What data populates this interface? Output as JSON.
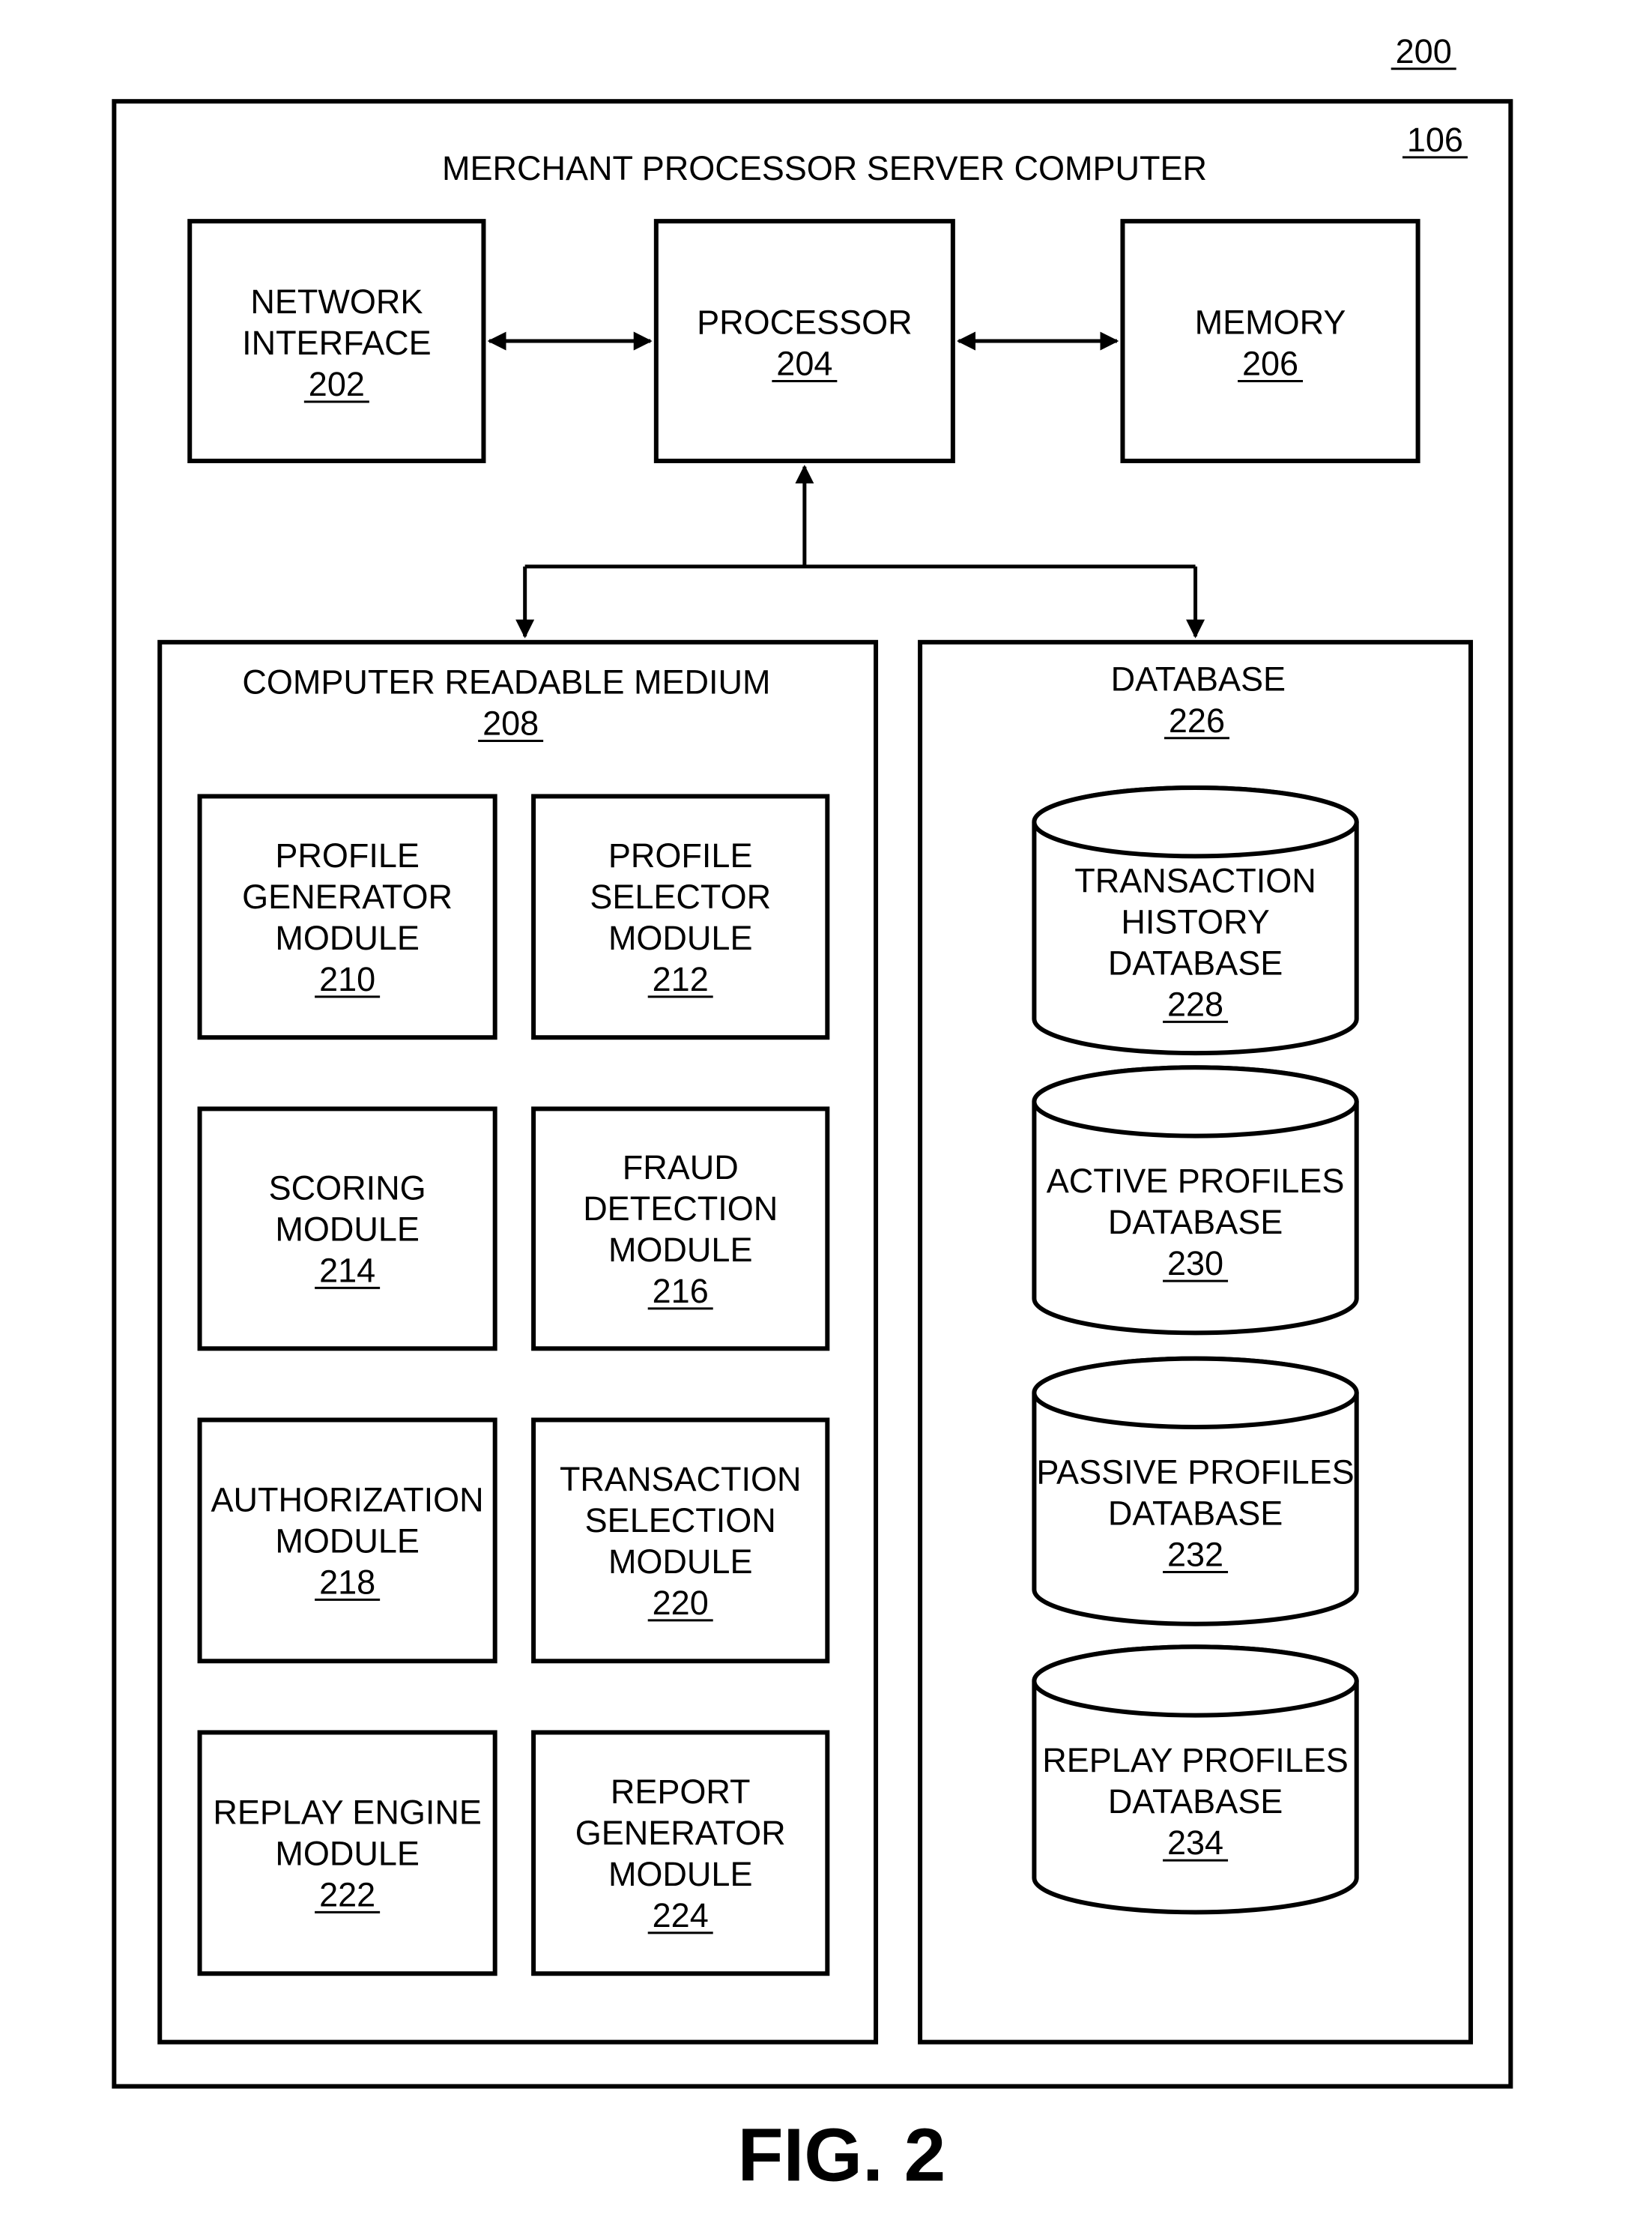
{
  "figure": {
    "ref": "200",
    "caption": "FIG. 2",
    "server": {
      "title": "MERCHANT PROCESSOR SERVER COMPUTER",
      "ref": "106"
    },
    "top_components": [
      {
        "id": "network",
        "lines": [
          "NETWORK",
          "INTERFACE"
        ],
        "ref": "202"
      },
      {
        "id": "processor",
        "lines": [
          "PROCESSOR"
        ],
        "ref": "204"
      },
      {
        "id": "memory",
        "lines": [
          "MEMORY"
        ],
        "ref": "206"
      }
    ],
    "crm": {
      "title": "COMPUTER READABLE MEDIUM",
      "ref": "208",
      "modules": [
        {
          "lines": [
            "PROFILE",
            "GENERATOR",
            "MODULE"
          ],
          "ref": "210"
        },
        {
          "lines": [
            "PROFILE",
            "SELECTOR",
            "MODULE"
          ],
          "ref": "212"
        },
        {
          "lines": [
            "SCORING",
            "MODULE"
          ],
          "ref": "214"
        },
        {
          "lines": [
            "FRAUD",
            "DETECTION",
            "MODULE"
          ],
          "ref": "216"
        },
        {
          "lines": [
            "AUTHORIZATION",
            "MODULE"
          ],
          "ref": "218"
        },
        {
          "lines": [
            "TRANSACTION",
            "SELECTION",
            "MODULE"
          ],
          "ref": "220"
        },
        {
          "lines": [
            "REPLAY ENGINE",
            "MODULE"
          ],
          "ref": "222"
        },
        {
          "lines": [
            "REPORT",
            "GENERATOR",
            "MODULE"
          ],
          "ref": "224"
        }
      ]
    },
    "database": {
      "title": "DATABASE",
      "ref": "226",
      "stores": [
        {
          "lines": [
            "TRANSACTION",
            "HISTORY",
            "DATABASE"
          ],
          "ref": "228"
        },
        {
          "lines": [
            "ACTIVE PROFILES",
            "DATABASE"
          ],
          "ref": "230"
        },
        {
          "lines": [
            "PASSIVE PROFILES",
            "DATABASE"
          ],
          "ref": "232"
        },
        {
          "lines": [
            "REPLAY PROFILES",
            "DATABASE"
          ],
          "ref": "234"
        }
      ]
    },
    "connections": [
      {
        "from": "network",
        "to": "processor",
        "type": "bidirectional"
      },
      {
        "from": "processor",
        "to": "memory",
        "type": "bidirectional"
      },
      {
        "from": "processor",
        "to": "crm",
        "type": "bidirectional"
      },
      {
        "from": "processor",
        "to": "database",
        "type": "bidirectional"
      }
    ]
  }
}
